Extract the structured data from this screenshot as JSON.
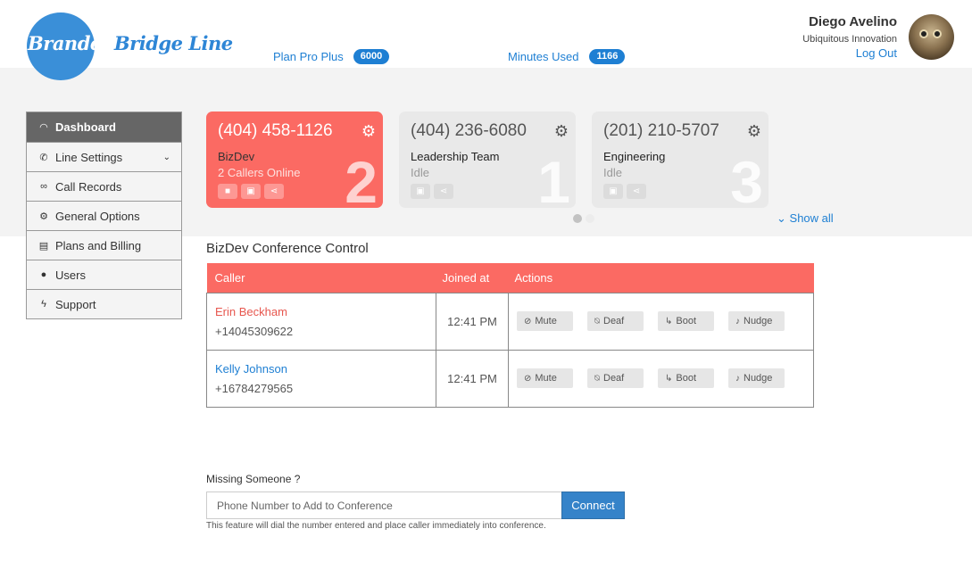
{
  "brand": {
    "logo_text_white": "Branded",
    "logo_text_blue": "Bridge Line"
  },
  "header": {
    "plan_label": "Plan Pro Plus",
    "plan_badge": "6000",
    "minutes_label": "Minutes Used",
    "minutes_badge": "1166"
  },
  "user": {
    "name": "Diego Avelino",
    "company": "Ubiquitous Innovation",
    "logout": "Log Out"
  },
  "sidebar": {
    "items": [
      {
        "label": "Dashboard",
        "icon": "gauge-icon",
        "glyph": "◠"
      },
      {
        "label": "Line Settings",
        "icon": "phone-icon",
        "glyph": "✆"
      },
      {
        "label": "Call Records",
        "icon": "voicemail-icon",
        "glyph": "∞"
      },
      {
        "label": "General Options",
        "icon": "gear-icon",
        "glyph": "⚙"
      },
      {
        "label": "Plans and Billing",
        "icon": "billing-icon",
        "glyph": "▤"
      },
      {
        "label": "Users",
        "icon": "user-icon",
        "glyph": "●"
      },
      {
        "label": "Support",
        "icon": "bolt-icon",
        "glyph": "ϟ"
      }
    ]
  },
  "lines": [
    {
      "phone": "(404) 458-1126",
      "name": "BizDev",
      "status": "2 Callers Online",
      "number": "2"
    },
    {
      "phone": "(404) 236-6080",
      "name": "Leadership Team",
      "status": "Idle",
      "number": "1"
    },
    {
      "phone": "(201) 210-5707",
      "name": "Engineering",
      "status": "Idle",
      "number": "3"
    }
  ],
  "carousel": {
    "show_all": "Show all"
  },
  "conference": {
    "title": "BizDev Conference Control",
    "columns": [
      "Caller",
      "Joined at",
      "Actions"
    ],
    "actions": [
      "Mute",
      "Deaf",
      "Boot",
      "Nudge"
    ],
    "rows": [
      {
        "name": "Erin Beckham",
        "phone": "+14045309622",
        "joined": "12:41 PM"
      },
      {
        "name": "Kelly Johnson",
        "phone": "+16784279565",
        "joined": "12:41 PM"
      }
    ]
  },
  "add_caller": {
    "label": "Missing Someone ?",
    "placeholder": "Phone Number to Add to Conference",
    "button": "Connect",
    "hint": "This feature will dial the number entered and place caller immediately into conference."
  },
  "colors": {
    "accent_red": "#fb6a63",
    "link_blue": "#1e7fd3",
    "button_blue": "#3583c9"
  }
}
